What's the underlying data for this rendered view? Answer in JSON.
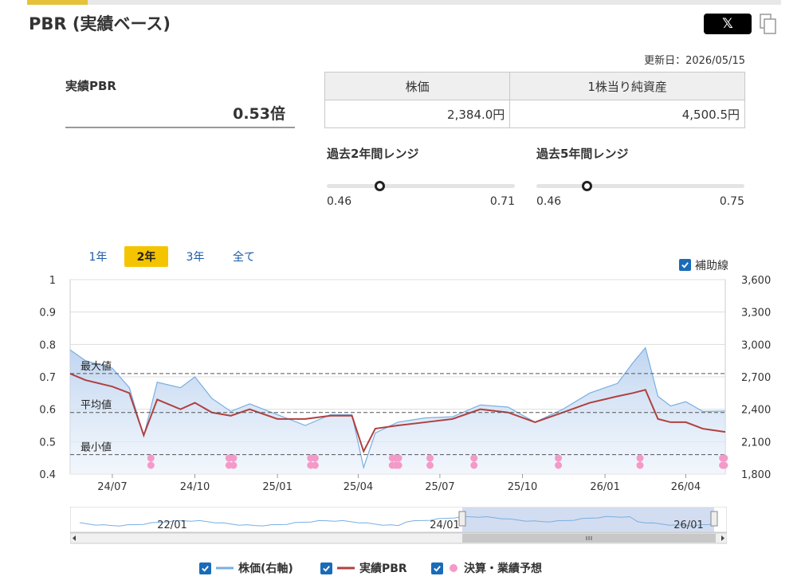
{
  "header": {
    "title": "PBR (実績ベース)",
    "share_x": "𝕏",
    "updated": "更新日：2026/05/15"
  },
  "summary": {
    "pbr_label": "実績PBR",
    "pbr_value": "0.53倍",
    "table_headers": [
      "株価",
      "1株当り純資産"
    ],
    "table_values": [
      "2,384.0円",
      "4,500.5円"
    ]
  },
  "ranges": [
    {
      "title": "過去2年間レンジ",
      "min": "0.46",
      "max": "0.71",
      "current": 0.53
    },
    {
      "title": "過去5年間レンジ",
      "min": "0.46",
      "max": "0.75",
      "current": 0.53
    }
  ],
  "periods": {
    "items": [
      "1年",
      "2年",
      "3年",
      "全て"
    ],
    "active": 1
  },
  "aux_toggle": {
    "label": "補助線",
    "checked": true
  },
  "legend": [
    {
      "label": "株価(右軸)",
      "color": "#7aafe0",
      "kind": "line"
    },
    {
      "label": "実績PBR",
      "color": "#b04040",
      "kind": "line"
    },
    {
      "label": "決算・業績予想",
      "color": "#f49ac8",
      "kind": "dot"
    }
  ],
  "navigator": {
    "labels": [
      "22/01",
      "24/01",
      "26/01"
    ]
  },
  "colors": {
    "accent": "#f5c400",
    "price": "#7aafe0",
    "pbr": "#b04040",
    "event": "#f49ac8",
    "checkbox": "#1a6bb8"
  },
  "chart_data": {
    "type": "line",
    "left_axis": {
      "ticks": [
        "1",
        "0.9",
        "0.8",
        "0.7",
        "0.6",
        "0.5",
        "0.4"
      ],
      "ylim": [
        0.4,
        1.0
      ]
    },
    "right_axis": {
      "ticks": [
        "3,600",
        "3,300",
        "3,000",
        "2,700",
        "2,400",
        "2,100",
        "1,800"
      ],
      "ylim": [
        1800,
        3600
      ]
    },
    "x_ticks": [
      "24/07",
      "24/10",
      "25/01",
      "25/04",
      "25/07",
      "25/10",
      "26/01",
      "26/04"
    ],
    "x_range": [
      "2024-05-15",
      "2026-05-15"
    ],
    "reference_lines": [
      {
        "label": "最大値",
        "value": 0.71
      },
      {
        "label": "平均値",
        "value": 0.59
      },
      {
        "label": "最小値",
        "value": 0.46
      }
    ],
    "series": [
      {
        "name": "株価(右軸)",
        "axis": "right",
        "x": [
          "2024-05-15",
          "2024-06-01",
          "2024-07-01",
          "2024-07-20",
          "2024-08-05",
          "2024-08-20",
          "2024-09-15",
          "2024-10-01",
          "2024-10-20",
          "2024-11-10",
          "2024-12-01",
          "2025-01-01",
          "2025-02-01",
          "2025-03-01",
          "2025-03-25",
          "2025-04-07",
          "2025-04-20",
          "2025-05-15",
          "2025-06-15",
          "2025-07-15",
          "2025-08-15",
          "2025-09-15",
          "2025-10-15",
          "2025-11-15",
          "2025-12-15",
          "2026-01-15",
          "2026-02-01",
          "2026-02-15",
          "2026-03-01",
          "2026-03-15",
          "2026-04-01",
          "2026-04-20",
          "2026-05-15"
        ],
        "values": [
          2950,
          2850,
          2780,
          2600,
          2150,
          2650,
          2600,
          2700,
          2500,
          2380,
          2450,
          2350,
          2250,
          2350,
          2350,
          1860,
          2180,
          2280,
          2320,
          2330,
          2440,
          2420,
          2280,
          2400,
          2550,
          2640,
          2830,
          2970,
          2520,
          2430,
          2470,
          2380,
          2384
        ]
      },
      {
        "name": "実績PBR",
        "axis": "left",
        "x": [
          "2024-05-15",
          "2024-06-01",
          "2024-07-01",
          "2024-07-20",
          "2024-08-05",
          "2024-08-20",
          "2024-09-15",
          "2024-10-01",
          "2024-10-20",
          "2024-11-10",
          "2024-12-01",
          "2025-01-01",
          "2025-02-01",
          "2025-03-01",
          "2025-03-25",
          "2025-04-07",
          "2025-04-20",
          "2025-05-15",
          "2025-06-15",
          "2025-07-15",
          "2025-08-15",
          "2025-09-15",
          "2025-10-15",
          "2025-11-15",
          "2025-12-15",
          "2026-01-15",
          "2026-02-01",
          "2026-02-15",
          "2026-03-01",
          "2026-03-15",
          "2026-04-01",
          "2026-04-20",
          "2026-05-15"
        ],
        "values": [
          0.71,
          0.69,
          0.67,
          0.65,
          0.52,
          0.63,
          0.6,
          0.62,
          0.59,
          0.58,
          0.6,
          0.57,
          0.57,
          0.58,
          0.58,
          0.47,
          0.54,
          0.55,
          0.56,
          0.57,
          0.6,
          0.59,
          0.56,
          0.59,
          0.62,
          0.64,
          0.65,
          0.66,
          0.57,
          0.56,
          0.56,
          0.54,
          0.53
        ]
      }
    ],
    "events": [
      "2024-08-13",
      "2024-11-08",
      "2024-11-13",
      "2025-02-07",
      "2025-02-12",
      "2025-05-09",
      "2025-05-13",
      "2025-05-16",
      "2025-06-20",
      "2025-08-08",
      "2025-11-10",
      "2026-02-09",
      "2026-05-12",
      "2026-05-14"
    ]
  }
}
